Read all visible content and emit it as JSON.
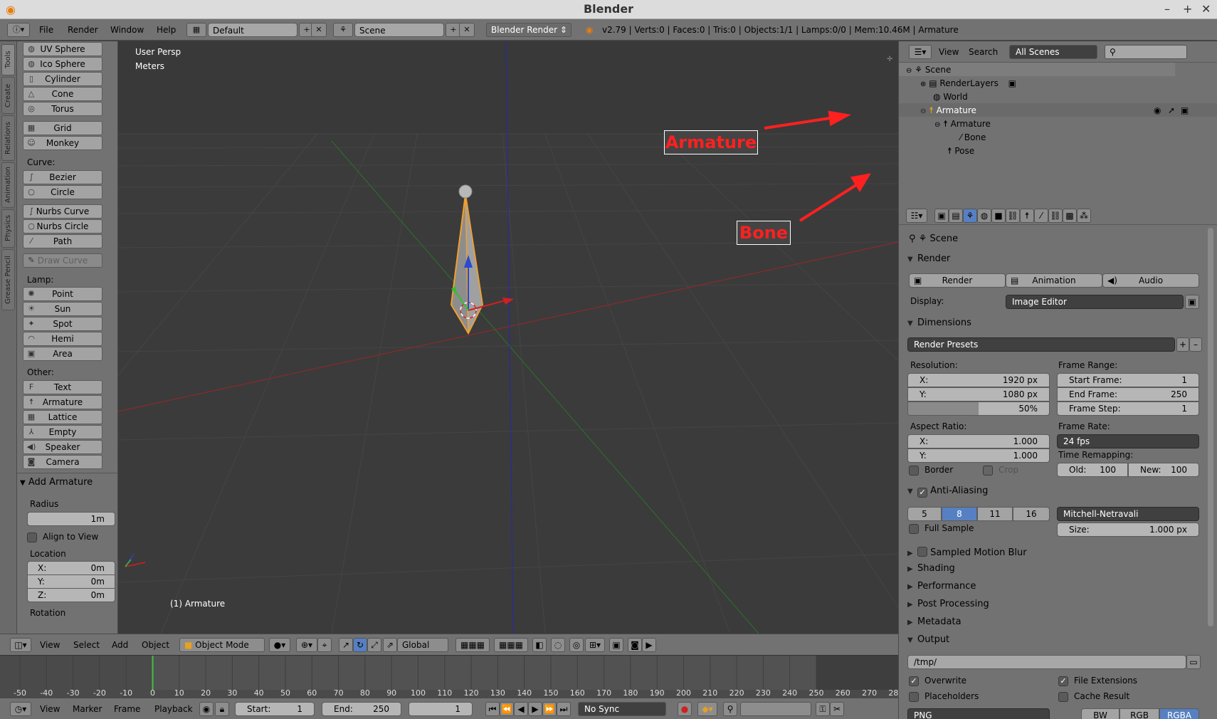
{
  "app": {
    "title": "Blender"
  },
  "info_bar": {
    "menus": [
      "File",
      "Render",
      "Window",
      "Help"
    ],
    "layout": "Default",
    "scene": "Scene",
    "engine": "Blender Render",
    "stats": "v2.79 | Verts:0 | Faces:0 | Tris:0 | Objects:1/1 | Lamps:0/0 | Mem:10.46M | Armature"
  },
  "tool_tabs": [
    "Tools",
    "Create",
    "Relations",
    "Animation",
    "Physics",
    "Grease Pencil"
  ],
  "tool_shelf": {
    "mesh_items": [
      "UV Sphere",
      "Ico Sphere",
      "Cylinder",
      "Cone",
      "Torus",
      "Grid",
      "Monkey"
    ],
    "curve_label": "Curve:",
    "curve_items": [
      "Bezier",
      "Circle",
      "Nurbs Curve",
      "Nurbs Circle",
      "Path",
      "Draw Curve"
    ],
    "lamp_label": "Lamp:",
    "lamp_items": [
      "Point",
      "Sun",
      "Spot",
      "Hemi",
      "Area"
    ],
    "other_label": "Other:",
    "other_items": [
      "Text",
      "Armature",
      "Lattice",
      "Empty",
      "Speaker",
      "Camera"
    ]
  },
  "operator_panel": {
    "title": "Add Armature",
    "radius_label": "Radius",
    "radius_value": "1m",
    "align_label": "Align to View",
    "location_label": "Location",
    "loc_x_label": "X:",
    "loc_x": "0m",
    "loc_y_label": "Y:",
    "loc_y": "0m",
    "loc_z_label": "Z:",
    "loc_z": "0m",
    "rotation_label": "Rotation"
  },
  "viewport": {
    "view_name": "User Persp",
    "units": "Meters",
    "object_label": "(1) Armature",
    "callout_armature": "Armature",
    "callout_bone": "Bone"
  },
  "viewport_header": {
    "menus": [
      "View",
      "Select",
      "Add",
      "Object"
    ],
    "mode": "Object Mode",
    "orientation": "Global"
  },
  "timeline": {
    "ticks": [
      "-50",
      "-40",
      "-30",
      "-20",
      "-10",
      "0",
      "10",
      "20",
      "30",
      "40",
      "50",
      "60",
      "70",
      "80",
      "90",
      "100",
      "110",
      "120",
      "130",
      "140",
      "150",
      "160",
      "170",
      "180",
      "190",
      "200",
      "210",
      "220",
      "230",
      "240",
      "250",
      "260",
      "270",
      "280"
    ],
    "current_frame_value": 0
  },
  "timeline_header": {
    "menus": [
      "View",
      "Marker",
      "Frame",
      "Playback"
    ],
    "start_label": "Start:",
    "start": "1",
    "end_label": "End:",
    "end": "250",
    "current": "1",
    "sync": "No Sync"
  },
  "outliner": {
    "menus": [
      "View",
      "Search"
    ],
    "filter": "All Scenes",
    "items": [
      "Scene",
      "RenderLayers",
      "World",
      "Armature",
      "Armature",
      "Bone",
      "Pose"
    ]
  },
  "properties": {
    "context": "Scene",
    "render_panel": "Render",
    "render_btn": "Render",
    "animation_btn": "Animation",
    "audio_btn": "Audio",
    "display_label": "Display:",
    "display_value": "Image Editor",
    "dimensions_panel": "Dimensions",
    "render_presets": "Render Presets",
    "resolution_label": "Resolution:",
    "res_x_label": "X:",
    "res_x": "1920 px",
    "res_y_label": "Y:",
    "res_y": "1080 px",
    "res_pct": "50%",
    "frame_range_label": "Frame Range:",
    "start_frame_label": "Start Frame:",
    "start_frame": "1",
    "end_frame_label": "End Frame:",
    "end_frame": "250",
    "frame_step_label": "Frame Step:",
    "frame_step": "1",
    "aspect_label": "Aspect Ratio:",
    "asp_x_label": "X:",
    "asp_x": "1.000",
    "asp_y_label": "Y:",
    "asp_y": "1.000",
    "frame_rate_label": "Frame Rate:",
    "frame_rate": "24 fps",
    "time_remap_label": "Time Remapping:",
    "old_label": "Old:",
    "old": "100",
    "new_label": "New:",
    "new": "100",
    "border_label": "Border",
    "crop_label": "Crop",
    "aa_panel": "Anti-Aliasing",
    "aa_samples": [
      "5",
      "8",
      "11",
      "16"
    ],
    "aa_selected": "8",
    "aa_filter": "Mitchell-Netravali",
    "full_sample_label": "Full Sample",
    "size_label": "Size:",
    "size": "1.000 px",
    "motion_blur_panel": "Sampled Motion Blur",
    "collapsed_panels": [
      "Shading",
      "Performance",
      "Post Processing",
      "Metadata"
    ],
    "output_panel": "Output",
    "output_path": "/tmp/",
    "overwrite_label": "Overwrite",
    "file_ext_label": "File Extensions",
    "placeholders_label": "Placeholders",
    "cache_label": "Cache Result",
    "format": "PNG",
    "color_modes": [
      "BW",
      "RGB",
      "RGBA"
    ],
    "color_selected": "RGBA"
  },
  "colors": {
    "accent": "#5680c2",
    "callout_red": "#ff2020",
    "bone_orange": "#f0a030"
  }
}
